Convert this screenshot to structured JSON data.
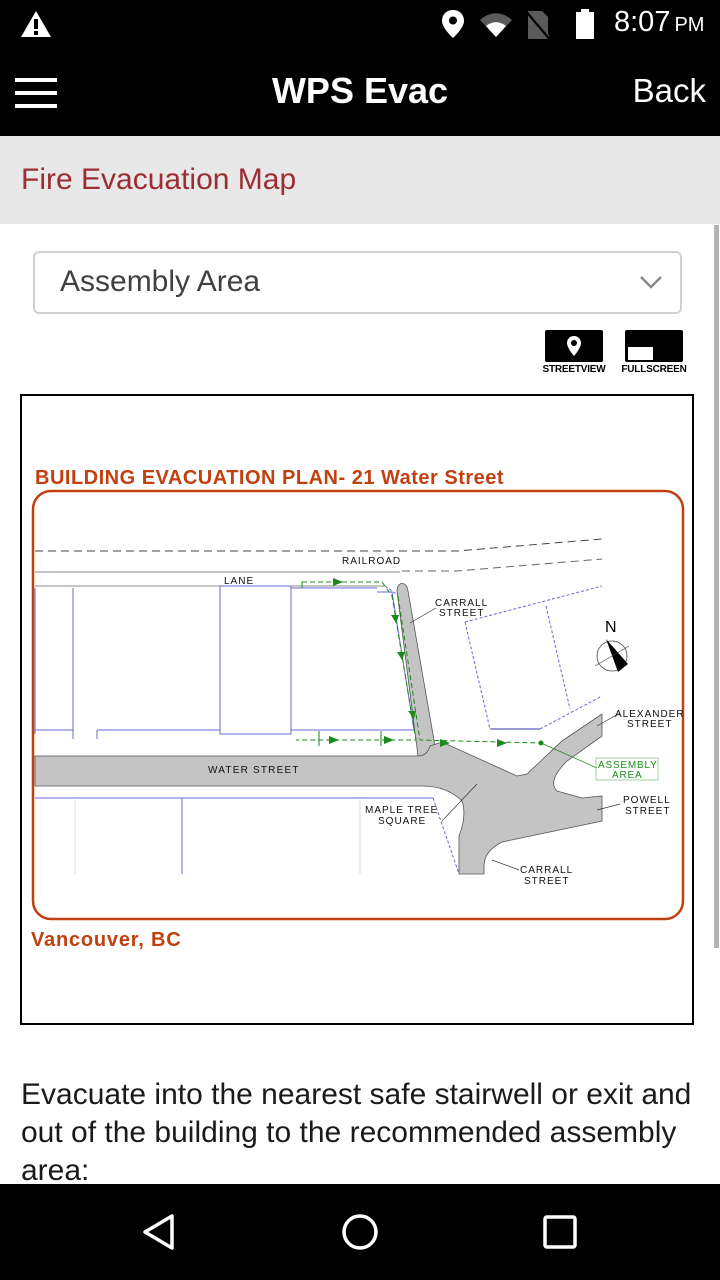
{
  "status_bar": {
    "time": "8:07",
    "ampm": "PM",
    "icons": [
      "warning-icon",
      "location-icon",
      "wifi-icon",
      "no-sim-icon",
      "battery-icon"
    ]
  },
  "app_bar": {
    "title": "WPS Evac",
    "back_label": "Back",
    "menu_icon": "hamburger-menu-icon"
  },
  "page": {
    "title": "Fire Evacuation Map",
    "title_color": "#9b2d33"
  },
  "dropdown": {
    "selected": "Assembly Area"
  },
  "map_buttons": {
    "streetview_label": "STREETVIEW",
    "fullscreen_label": "FULLSCREEN"
  },
  "map": {
    "title": "BUILDING EVACUATION PLAN- 21 Water Street",
    "footer": "Vancouver, BC",
    "accent_color": "#c0400f",
    "route_color": "#1a8a1a",
    "labels": {
      "railroad": "RAILROAD",
      "lane": "LANE",
      "carrall_north_1": "CARRALL",
      "carrall_north_2": "STREET",
      "water_street": "WATER STREET",
      "maple_1": "MAPLE TREE",
      "maple_2": "SQUARE",
      "alexander_1": "ALEXANDER",
      "alexander_2": "STREET",
      "assembly_1": "ASSEMBLY",
      "assembly_2": "AREA",
      "powell_1": "POWELL",
      "powell_2": "STREET",
      "carrall_south_1": "CARRALL",
      "carrall_south_2": "STREET",
      "north": "N"
    }
  },
  "description": "Evacuate into the nearest safe stairwell or exit and out of the building to the recommended assembly area:",
  "nav_bar": {
    "buttons": [
      "back",
      "home",
      "recents"
    ]
  }
}
